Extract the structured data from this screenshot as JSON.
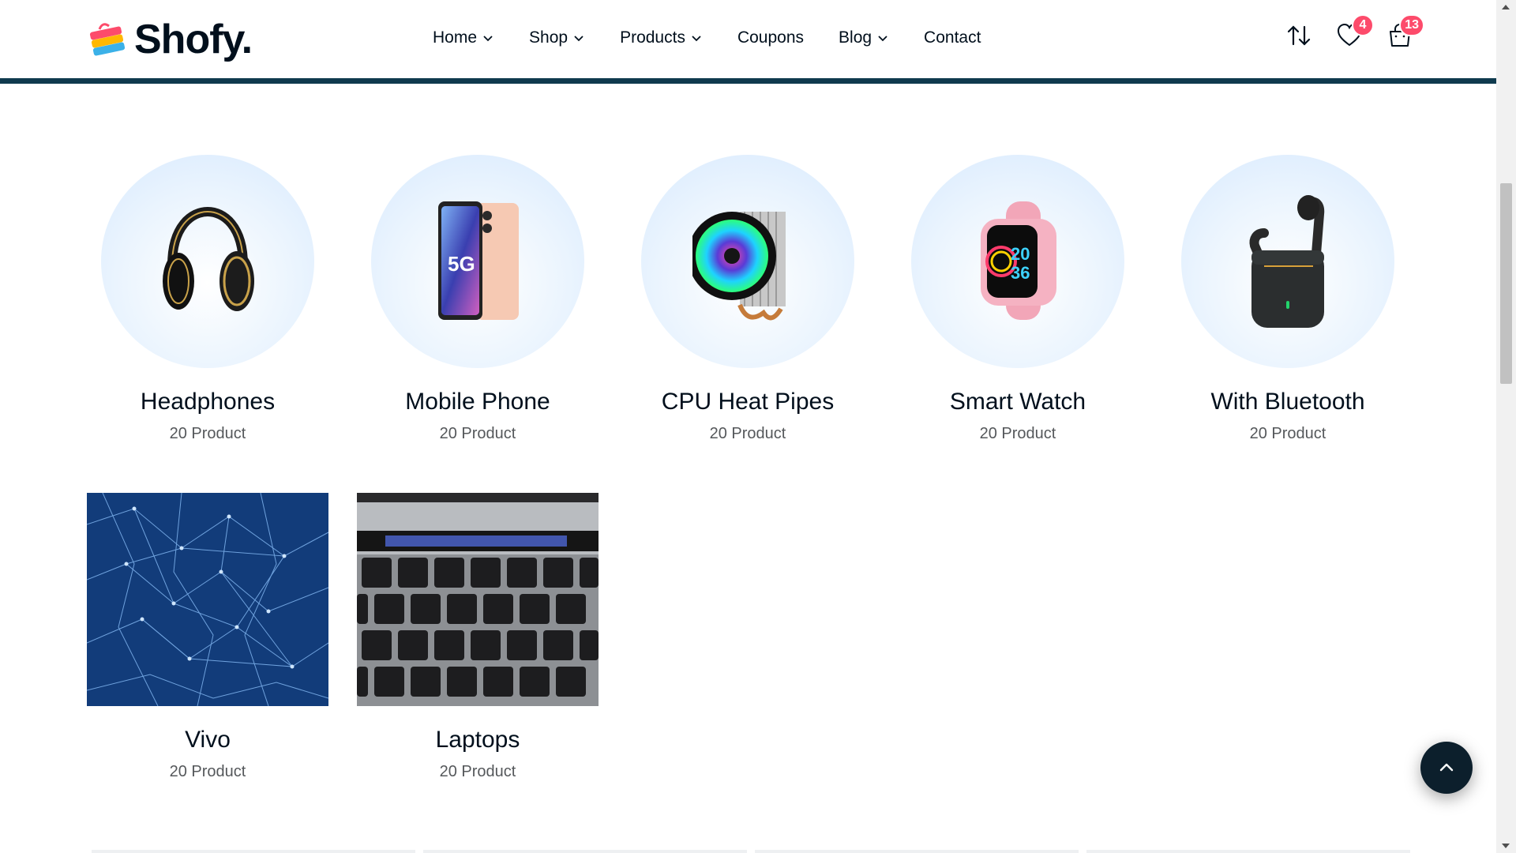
{
  "brand": {
    "name": "Shofy."
  },
  "nav": [
    {
      "label": "Home",
      "dropdown": true
    },
    {
      "label": "Shop",
      "dropdown": true
    },
    {
      "label": "Products",
      "dropdown": true
    },
    {
      "label": "Coupons",
      "dropdown": false
    },
    {
      "label": "Blog",
      "dropdown": true
    },
    {
      "label": "Contact",
      "dropdown": false
    }
  ],
  "header_icons": {
    "compare_icon": "arrows-up-down-icon",
    "wishlist_icon": "heart-icon",
    "wishlist_count": "4",
    "cart_icon": "shopping-bag-icon",
    "cart_count": "13"
  },
  "categories": [
    {
      "title": "Headphones",
      "count": "20 Product",
      "icon": "headphones-icon"
    },
    {
      "title": "Mobile Phone",
      "count": "20 Product",
      "icon": "mobile-phone-icon"
    },
    {
      "title": "CPU Heat Pipes",
      "count": "20 Product",
      "icon": "cpu-cooler-icon"
    },
    {
      "title": "Smart Watch",
      "count": "20 Product",
      "icon": "smart-watch-icon"
    },
    {
      "title": "With Bluetooth",
      "count": "20 Product",
      "icon": "earbuds-icon"
    },
    {
      "title": "Vivo",
      "count": "20 Product",
      "icon": "network-image"
    },
    {
      "title": "Laptops",
      "count": "20 Product",
      "icon": "keyboard-image"
    }
  ],
  "colors": {
    "accent": "#0f3a4e",
    "badge": "#fd4b6b",
    "circle_bg": "#e5f1fd"
  }
}
